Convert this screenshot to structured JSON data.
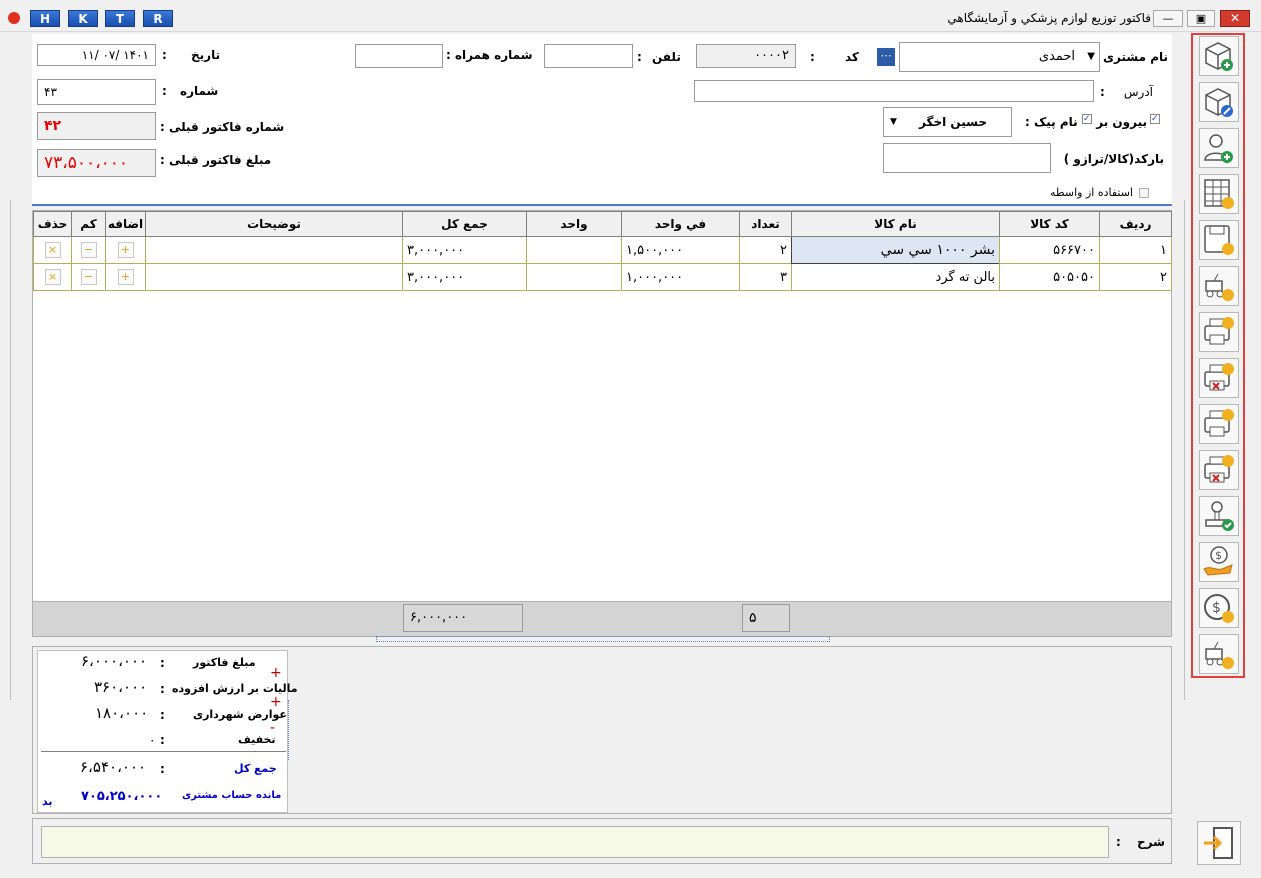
{
  "window": {
    "title": "فاکتور توزیع لوازم پزشکي و آزمايشگاهي",
    "hk_buttons": [
      "H",
      "K",
      "T",
      "R"
    ],
    "controls": [
      "—",
      "▣",
      "✕"
    ]
  },
  "header": {
    "customer_name_label": "نام مشتری :",
    "customer_name": "احمدی",
    "code_label": "کد",
    "code_colon": ":",
    "code_value": "۰۰۰۰۲",
    "phone_label": "تلفن",
    "phone_colon": ":",
    "mobile_label": "شماره همراه :",
    "date_label": "تاریخ",
    "date_colon": ":",
    "date_value": "۱۴۰۱    /۰۷    /۱۱",
    "address_label": "آدرس",
    "address_colon": ":",
    "number_label": "شماره",
    "number_colon": ":",
    "number_value": "۴۳",
    "outside_label": "بیرون بر",
    "courier_label": "نام پیک :",
    "courier_value": "حسین اخگر",
    "prev_invoice_no_label": "شماره فاکتور قبلی :",
    "prev_invoice_no": "۴۲",
    "barcode_label": "بارکد(کالا/ترازو )",
    "prev_invoice_amount_label": "مبلغ فاکتور قبلی :",
    "prev_invoice_amount": "۷۳،۵۰۰،۰۰۰",
    "broker_label": "استفاده از واسطه"
  },
  "table": {
    "columns": [
      "ردیف",
      "کد کالا",
      "نام کالا",
      "تعداد",
      "في واحد",
      "واحد",
      "جمع کل",
      "توضیحات",
      "اضافه",
      "کم",
      "حذف"
    ],
    "rows": [
      {
        "row": "۱",
        "code": "۵۶۶۷۰۰",
        "name": "بشر ۱۰۰۰ سي سي",
        "qty": "۲",
        "unit_price": "۱,۵۰۰,۰۰۰",
        "unit": "",
        "total": "۳,۰۰۰,۰۰۰",
        "desc": ""
      },
      {
        "row": "۲",
        "code": "۵۰۵۰۵۰",
        "name": "بالن ته گرد",
        "qty": "۳",
        "unit_price": "۱,۰۰۰,۰۰۰",
        "unit": "",
        "total": "۳,۰۰۰,۰۰۰",
        "desc": ""
      }
    ],
    "footer_qty": "۵",
    "footer_total": "۶,۰۰۰,۰۰۰",
    "add_glyph": "+",
    "minus_glyph": "−",
    "delete_glyph": "×"
  },
  "summary": {
    "invoice_amount_label": "مبلغ فاکتور",
    "invoice_amount": "۶،۰۰۰،۰۰۰",
    "vat_label": "مالیات بر ارزش افزوده",
    "vat": "۳۶۰،۰۰۰",
    "municipal_label": "عوارض شهرداری",
    "municipal": "۱۸۰،۰۰۰",
    "discount_label": "تخفیف",
    "discount": "۰",
    "total_label": "جمع کل",
    "total": "۶،۵۴۰،۰۰۰",
    "balance_label": "مانده حساب مشتری",
    "balance": "۷۰۵،۲۵۰،۰۰۰",
    "balance_status": "بد",
    "plus": "+",
    "minus": "-",
    "colon": ":"
  },
  "notes": {
    "label": "شرح",
    "colon": ":"
  },
  "colors": {
    "accent": "#e04040",
    "debt": "#0000c0",
    "prev": "#e00000"
  },
  "toolbar_icons": [
    "new-box-icon",
    "edit-box-icon",
    "add-person-icon",
    "calculator-table-icon",
    "save-view-icon",
    "delivery-view-icon",
    "print-money-icon",
    "print-cancel-money-icon",
    "print-coin-icon",
    "print-cancel-coin-icon",
    "stamp-check-icon",
    "hand-money-icon",
    "coin-refresh-icon",
    "delivery-coin-icon"
  ],
  "exit_icon": "exit-door-icon"
}
